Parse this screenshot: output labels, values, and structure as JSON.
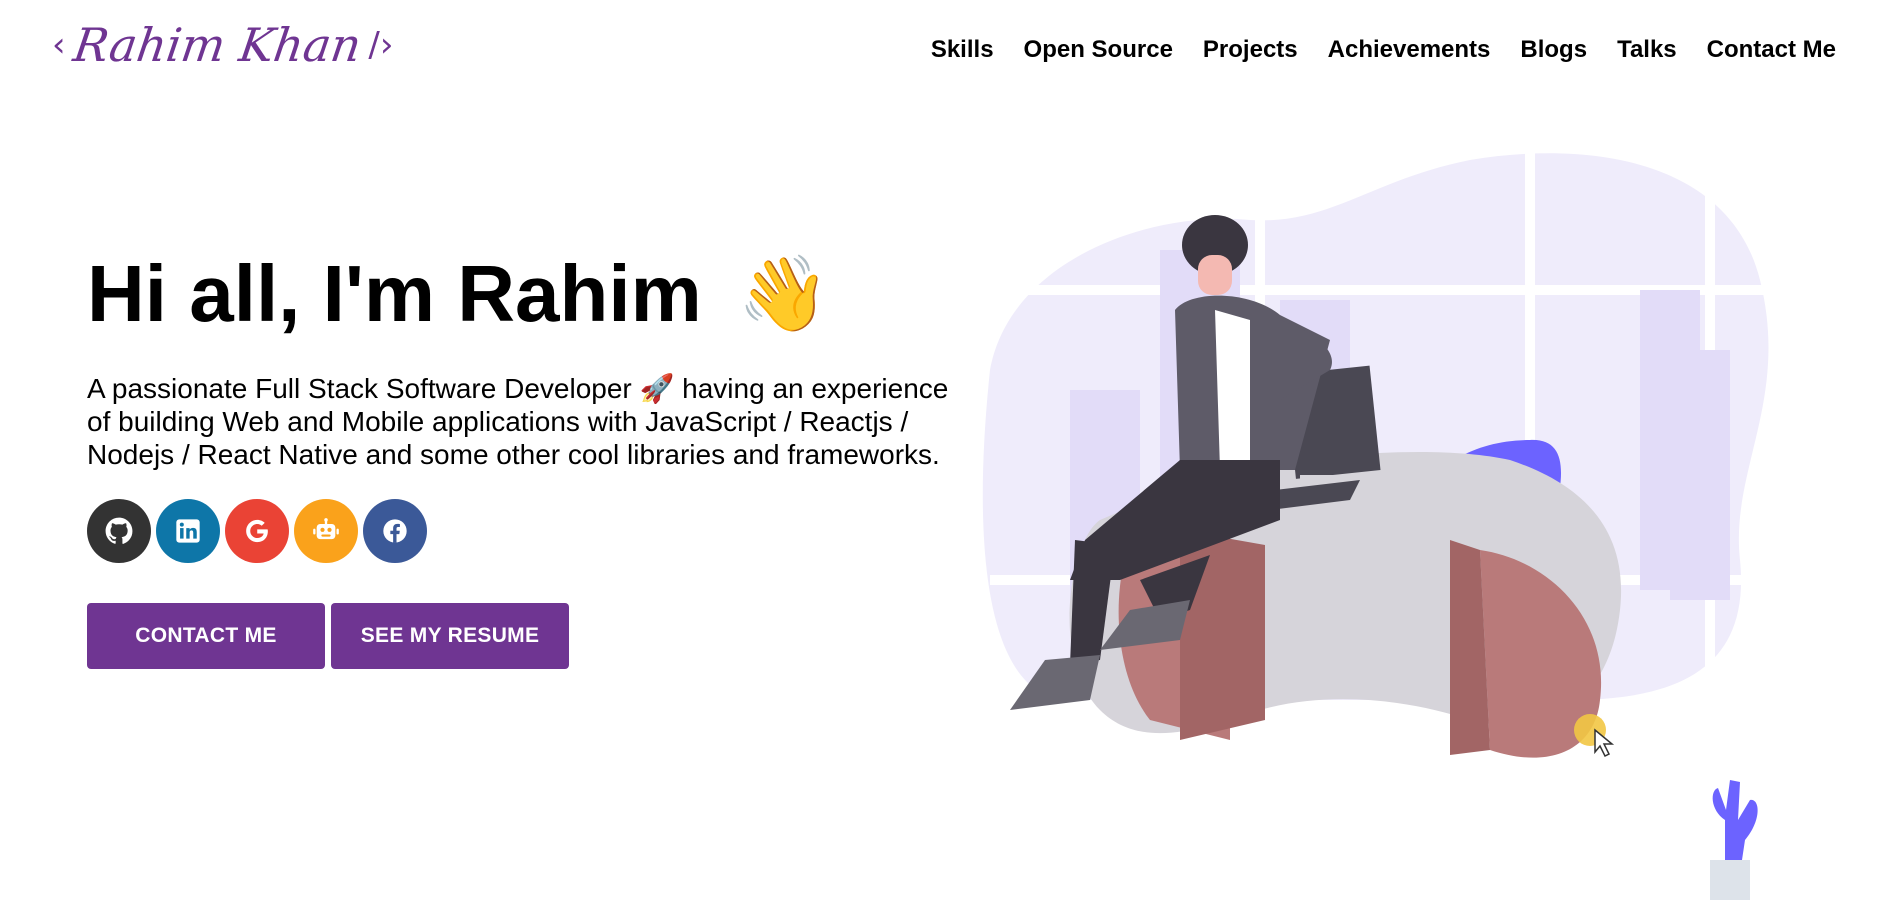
{
  "header": {
    "logo": {
      "open_bracket": "‹",
      "name": "Rahim Khan",
      "close_bracket": "/›"
    },
    "nav": [
      {
        "label": "Skills"
      },
      {
        "label": "Open Source"
      },
      {
        "label": "Projects"
      },
      {
        "label": "Achievements"
      },
      {
        "label": "Blogs"
      },
      {
        "label": "Talks"
      },
      {
        "label": "Contact Me"
      }
    ]
  },
  "hero": {
    "title": "Hi all, I'm Rahim",
    "wave_emoji": "👋",
    "subtitle": "A passionate Full Stack Software Developer 🚀 having an experience of building Web and Mobile applications with JavaScript / Reactjs / Nodejs / React Native and some other cool libraries and frameworks.",
    "socials": [
      {
        "icon": "github-icon",
        "color": "#333333"
      },
      {
        "icon": "linkedin-icon",
        "color": "#0e76a8"
      },
      {
        "icon": "google-icon",
        "color": "#ea4335"
      },
      {
        "icon": "gitlab-robot-icon",
        "color": "#faa21b"
      },
      {
        "icon": "facebook-icon",
        "color": "#3b5998"
      }
    ],
    "buttons": {
      "contact": "CONTACT ME",
      "resume": "SEE MY RESUME"
    }
  },
  "colors": {
    "brand": "#6f3592",
    "accent_illustration": "#6c63ff"
  }
}
